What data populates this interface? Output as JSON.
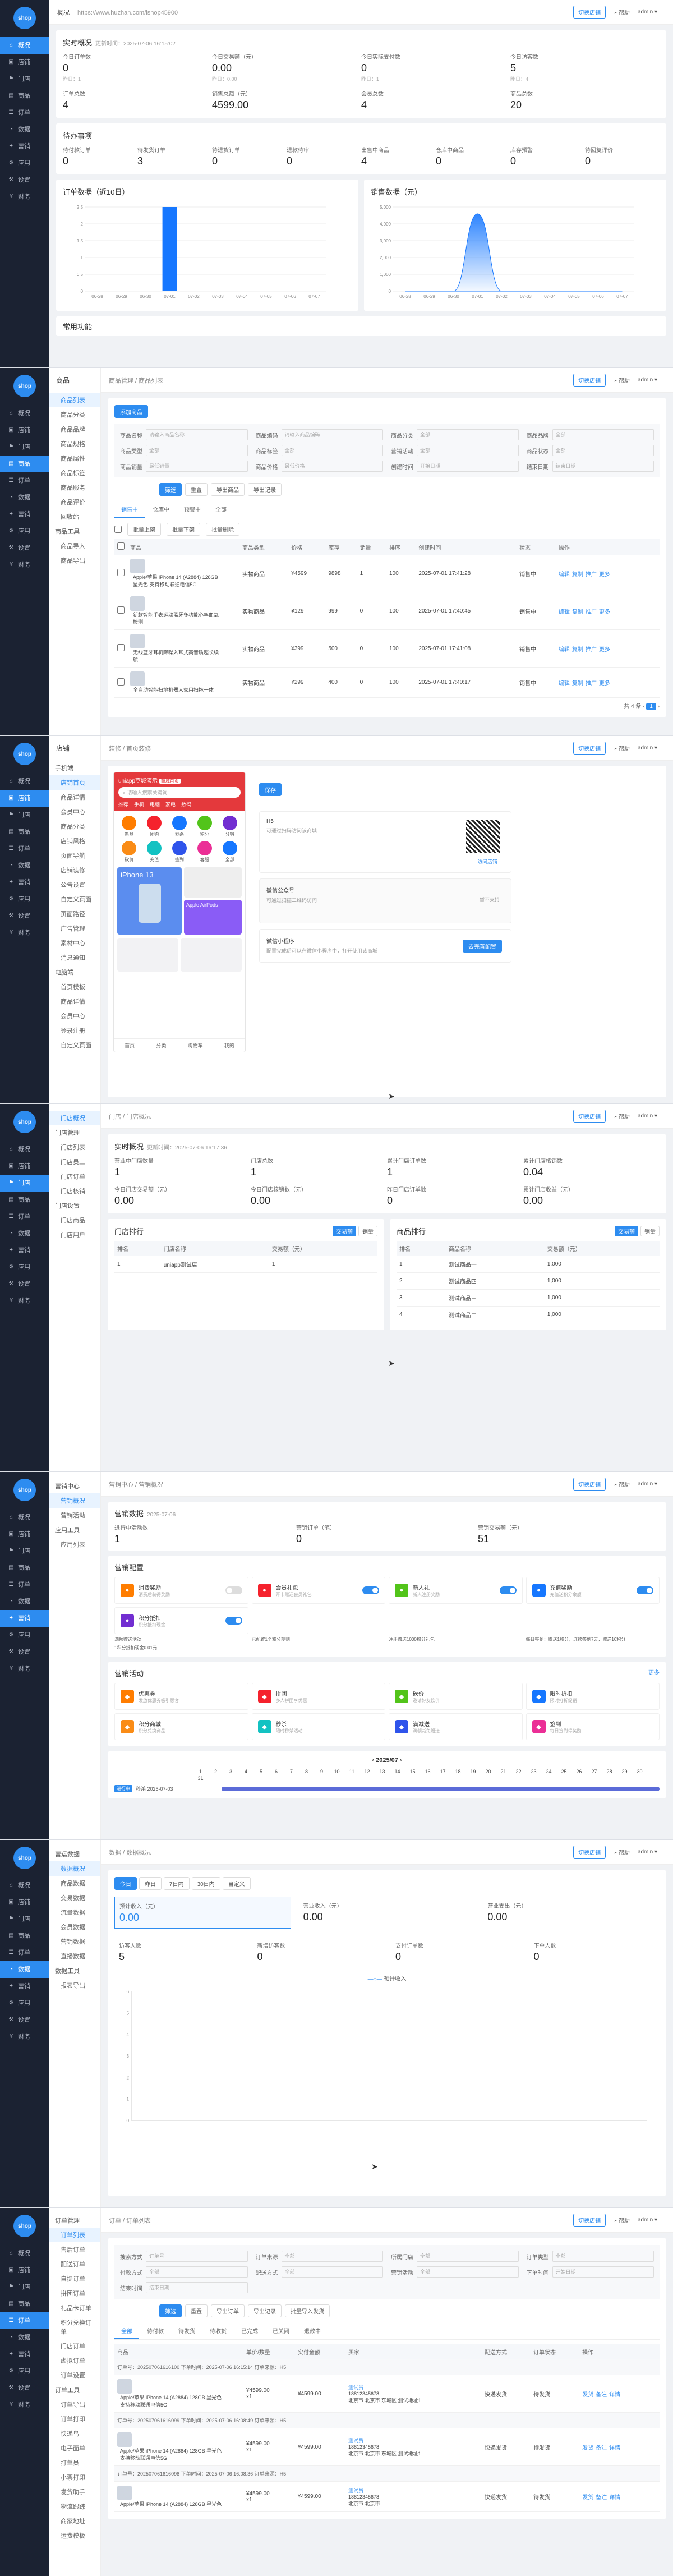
{
  "watermark": "https://www.huzhan.com/ishop45900",
  "user": {
    "avatar": "admin",
    "name": "admin",
    "help": "帮助",
    "store_btn": "切换店铺"
  },
  "menu": [
    "概况",
    "店铺",
    "门店",
    "商品",
    "订单",
    "数据",
    "营销",
    "应用",
    "设置",
    "财务"
  ],
  "s1": {
    "bc": "概况",
    "rt_title": "实时概况",
    "rt_time": "更新时间：2025-07-06 16:15:02",
    "kpis": [
      {
        "l": "今日订单数",
        "v": "0",
        "s": "昨日：1"
      },
      {
        "l": "今日交易额（元）",
        "v": "0.00",
        "s": "昨日：0.00"
      },
      {
        "l": "今日实际支付数",
        "v": "0",
        "s": "昨日：1"
      },
      {
        "l": "今日访客数",
        "v": "5",
        "s": "昨日：4"
      },
      {
        "l": "订单总数",
        "v": "4",
        "s": ""
      },
      {
        "l": "销售总额（元）",
        "v": "4599.00",
        "s": ""
      },
      {
        "l": "会员总数",
        "v": "4",
        "s": ""
      },
      {
        "l": "商品总数",
        "v": "20",
        "s": ""
      }
    ],
    "todo_title": "待办事项",
    "todo": [
      {
        "l": "待付款订单",
        "v": "0"
      },
      {
        "l": "待发货订单",
        "v": "3"
      },
      {
        "l": "待退货订单",
        "v": "0"
      },
      {
        "l": "退款待审",
        "v": "0"
      },
      {
        "l": "出售中商品",
        "v": "4"
      },
      {
        "l": "仓库中商品",
        "v": "0"
      },
      {
        "l": "库存预警",
        "v": "0"
      },
      {
        "l": "待回复评价",
        "v": "0"
      }
    ],
    "chart1_title": "订单数据（近10日）",
    "chart2_title": "销售数据（元）",
    "shop_title": "常用功能"
  },
  "chart_data": [
    {
      "type": "bar",
      "title": "订单数据（近10日）",
      "categories": [
        "06-28",
        "06-29",
        "06-30",
        "07-01",
        "07-02",
        "07-03",
        "07-04",
        "07-05",
        "07-06",
        "07-07"
      ],
      "values": [
        0,
        0,
        0,
        2.5,
        0,
        0,
        0,
        0,
        0,
        0
      ],
      "ylim": [
        0,
        2.5
      ],
      "yticks": [
        "0",
        "0.5",
        "1",
        "1.5",
        "2",
        "2.5"
      ],
      "color": "#1677ff"
    },
    {
      "type": "area",
      "title": "销售数据（元）",
      "categories": [
        "06-28",
        "06-29",
        "06-30",
        "07-01",
        "07-02",
        "07-03",
        "07-04",
        "07-05",
        "07-06",
        "07-07"
      ],
      "values": [
        0,
        0,
        0,
        4599,
        0,
        0,
        0,
        0,
        0,
        0
      ],
      "ylim": [
        0,
        5000
      ],
      "yticks": [
        "0",
        "1,000",
        "2,000",
        "3,000",
        "4,000",
        "5,000"
      ],
      "color": "#1677ff"
    }
  ],
  "s2": {
    "bc": "商品管理 / 商品列表",
    "side_title": "商品",
    "side": [
      "商品列表",
      "商品分类",
      "商品品牌",
      "商品规格",
      "商品属性",
      "商品标签",
      "商品服务",
      "商品评价",
      "回收站",
      "商品工具",
      "商品导入",
      "商品导出"
    ],
    "add": "添加商品",
    "fields": [
      {
        "l": "商品名称",
        "p": "请输入商品名称"
      },
      {
        "l": "商品编码",
        "p": "请输入商品编码"
      },
      {
        "l": "商品分类",
        "p": "全部"
      },
      {
        "l": "商品品牌",
        "p": "全部"
      },
      {
        "l": "商品类型",
        "p": "全部"
      },
      {
        "l": "商品标签",
        "p": "全部"
      },
      {
        "l": "营销活动",
        "p": "全部"
      },
      {
        "l": "商品状态",
        "p": "全部"
      },
      {
        "l": "商品销量",
        "p": "最低销量"
      },
      {
        "l": "商品价格",
        "p": "最低价格"
      },
      {
        "l": "创建时间",
        "p": "开始日期"
      },
      {
        "l": "结束日期",
        "p": "结束日期"
      }
    ],
    "btns": [
      "筛选",
      "重置",
      "导出商品",
      "导出记录"
    ],
    "tabs": [
      "销售中",
      "仓库中",
      "预警中",
      "全部"
    ],
    "batch": [
      "批量上架",
      "批量下架",
      "批量删除"
    ],
    "cols": [
      "商品",
      "商品类型",
      "价格",
      "库存",
      "销量",
      "排序",
      "创建时间",
      "状态",
      "操作"
    ],
    "rows": [
      {
        "n": "Apple/苹果 iPhone 14 (A2884) 128GB 星光色 支持移动联通电信5G",
        "t": "实物商品",
        "p": "¥4599",
        "s": "9898",
        "x": "1",
        "o": "100",
        "d": "2025-07-01 17:41:28",
        "st": "销售中"
      },
      {
        "n": "新款智能手表运动蓝牙多功能心率血氧检测",
        "t": "实物商品",
        "p": "¥129",
        "s": "999",
        "x": "0",
        "o": "100",
        "d": "2025-07-01 17:40:45",
        "st": "销售中"
      },
      {
        "n": "无线蓝牙耳机降噪入耳式高音质超长续航",
        "t": "实物商品",
        "p": "¥399",
        "s": "500",
        "x": "0",
        "o": "100",
        "d": "2025-07-01 17:41:08",
        "st": "销售中"
      },
      {
        "n": "全自动智能扫地机器人家用扫拖一体",
        "t": "实物商品",
        "p": "¥299",
        "s": "400",
        "x": "0",
        "o": "100",
        "d": "2025-07-01 17:40:17",
        "st": "销售中"
      }
    ],
    "ops": [
      "编辑",
      "复制",
      "推广",
      "更多"
    ],
    "pager": "共 4 条"
  },
  "s3": {
    "bc": "装修 / 首页装修",
    "side_title": "店铺",
    "side": [
      "手机端",
      "店铺首页",
      "商品详情",
      "会员中心",
      "商品分类",
      "店铺风格",
      "页面导航",
      "店铺装修",
      "公告设置",
      "自定义页面",
      "页面路径",
      "广告管理",
      "素材中心",
      "消息通知",
      "电脑端",
      "首页模板",
      "商品详情",
      "会员中心",
      "登录注册",
      "自定义页面"
    ],
    "shop_name": "uniapp商城演示",
    "shop_tag": "商城首页",
    "search": "请输入搜索关键词",
    "cats": [
      "推荐",
      "手机",
      "电脑",
      "家电",
      "数码"
    ],
    "icons": [
      "新品",
      "团购",
      "秒杀",
      "积分",
      "分销",
      "砍价",
      "充值",
      "签到",
      "客服",
      "全部"
    ],
    "banner": "iPhone 13",
    "promo": "Apple AirPods",
    "tabbar": [
      "首页",
      "分类",
      "购物车",
      "我的"
    ],
    "save": "保存",
    "h5_title": "H5",
    "h5_desc": "可通过扫码访问该商城",
    "h5_btn": "访问店铺",
    "mp_title": "微信公众号",
    "mp_desc": "可通过扫描二维码访问",
    "mp_btn": "暂不支持",
    "wx_title": "微信小程序",
    "wx_desc": "配置完成后可以在微信小程序中，打开使用该商城",
    "wx_btn": "去完善配置"
  },
  "s4": {
    "bc": "门店 / 门店概况",
    "side": [
      "门店概况",
      "门店管理",
      "门店列表",
      "门店员工",
      "门店订单",
      "门店核销",
      "门店设置",
      "门店商品",
      "门店用户"
    ],
    "rt_title": "实时概况",
    "rt_time": "更新时间：2025-07-06 16:17:36",
    "kpis": [
      {
        "l": "营业中门店数量",
        "v": "1"
      },
      {
        "l": "门店总数",
        "v": "1"
      },
      {
        "l": "累计门店订单数",
        "v": "1"
      },
      {
        "l": "累计门店核销数",
        "v": "0.04"
      },
      {
        "l": "今日门店交易额（元）",
        "v": "0.00"
      },
      {
        "l": "今日门店核销数（元）",
        "v": "0.00"
      },
      {
        "l": "昨日门店订单数",
        "v": "0"
      },
      {
        "l": "累计门店收益（元）",
        "v": "0.00"
      }
    ],
    "rank1": "门店排行",
    "rank2": "商品排行",
    "tab1": "交易额",
    "tab2": "销量",
    "r1cols": [
      "排名",
      "门店名称",
      "交易额（元）"
    ],
    "r1rows": [
      {
        "a": "1",
        "b": "uniapp测试店",
        "c": "1"
      }
    ],
    "r2cols": [
      "排名",
      "商品名称",
      "交易额（元）"
    ],
    "r2rows": [
      {
        "a": "1",
        "b": "测试商品一",
        "c": "1,000"
      },
      {
        "a": "2",
        "b": "测试商品四",
        "c": "1,000"
      },
      {
        "a": "3",
        "b": "测试商品三",
        "c": "1,000"
      },
      {
        "a": "4",
        "b": "测试商品二",
        "c": "1,000"
      }
    ]
  },
  "s5": {
    "bc": "营销中心 / 营销概况",
    "side": [
      "营销中心",
      "营销概况",
      "营销活动",
      "应用工具",
      "应用列表"
    ],
    "ov_title": "营销数据",
    "ov_time": "2025-07-06",
    "kpis": [
      {
        "l": "进行中活动数",
        "v": "1"
      },
      {
        "l": "营销订单（笔）",
        "v": "0"
      },
      {
        "l": "营销交易额（元）",
        "v": "51"
      }
    ],
    "cfg_title": "营销配置",
    "cfgs": [
      {
        "t": "消费奖励",
        "d": "消费后获得奖励",
        "c": "#ff7d00",
        "on": false
      },
      {
        "t": "会员礼包",
        "d": "开卡赠送会员礼包",
        "c": "#f5222d",
        "on": true
      },
      {
        "t": "新人礼",
        "d": "新人注册奖励",
        "c": "#52c41a",
        "on": true
      },
      {
        "t": "充值奖励",
        "d": "充值送积分余额",
        "c": "#1677ff",
        "on": true
      },
      {
        "t": "积分抵扣",
        "d": "积分抵扣现金",
        "c": "#722ed1",
        "on": true
      }
    ],
    "cfg_notes": [
      "满额赠送活动",
      "已配置1个积分规则",
      "注册赠送1000积分礼包",
      "每日签到：赠送1积分，连续签到7天，赠送10积分"
    ],
    "sign_note": "1积分抵扣现金0.01元",
    "act_title": "营销活动",
    "act_more": "更多",
    "acts": [
      {
        "t": "优惠券",
        "d": "发放优惠券吸引顾客",
        "c": "#ff7d00"
      },
      {
        "t": "拼团",
        "d": "多人拼团享优惠",
        "c": "#f5222d"
      },
      {
        "t": "砍价",
        "d": "邀请好友砍价",
        "c": "#52c41a"
      },
      {
        "t": "限时折扣",
        "d": "限时打折促销",
        "c": "#1677ff"
      },
      {
        "t": "积分商城",
        "d": "积分兑换商品",
        "c": "#fa8c16"
      },
      {
        "t": "秒杀",
        "d": "限时秒杀活动",
        "c": "#13c2c2"
      },
      {
        "t": "满减送",
        "d": "满额减免赠送",
        "c": "#2f54eb"
      },
      {
        "t": "签到",
        "d": "每日签到得奖励",
        "c": "#eb2f96"
      }
    ],
    "month": "2025/07",
    "days": [
      "1",
      "2",
      "3",
      "4",
      "5",
      "6",
      "7",
      "8",
      "9",
      "10",
      "11",
      "12",
      "13",
      "14",
      "15",
      "16",
      "17",
      "18",
      "19",
      "20",
      "21",
      "22",
      "23",
      "24",
      "25",
      "26",
      "27",
      "28",
      "29",
      "30",
      "31"
    ],
    "cal_tag": "进行中",
    "cal_ev": "秒杀 2025-07-03"
  },
  "s6": {
    "bc": "数据 / 数据概况",
    "side": [
      "营运数据",
      "数据概况",
      "商品数据",
      "交易数据",
      "流量数据",
      "会员数据",
      "营销数据",
      "直播数据",
      "数据工具",
      "报表导出"
    ],
    "ranges": [
      "今日",
      "昨日",
      "7日内",
      "30日内",
      "自定义"
    ],
    "kpis": [
      {
        "l": "预计收入（元）",
        "v": "0.00"
      },
      {
        "l": "营业收入（元）",
        "v": "0.00"
      },
      {
        "l": "营业支出（元）",
        "v": "0.00"
      },
      {
        "l": "访客人数",
        "v": "5"
      },
      {
        "l": "新增访客数",
        "v": "0"
      },
      {
        "l": "支付订单数",
        "v": "0"
      },
      {
        "l": "下单人数",
        "v": "0"
      }
    ],
    "legend": "预计收入",
    "ylabels": [
      "0",
      "1",
      "2",
      "3",
      "4",
      "5",
      "6"
    ]
  },
  "s7": {
    "bc": "订单 / 订单列表",
    "side_title": "订单管理",
    "side": [
      "订单列表",
      "售后订单",
      "配送订单",
      "自提订单",
      "拼团订单",
      "礼品卡订单",
      "积分兑换订单",
      "门店订单",
      "虚拟订单",
      "订单设置",
      "订单工具",
      "订单导出",
      "订单打印",
      "快递鸟",
      "电子面单",
      "打单员",
      "小票打印",
      "发货助手",
      "物流跟踪",
      "商家地址",
      "运费模板"
    ],
    "fields": [
      {
        "l": "搜索方式",
        "p": "订单号"
      },
      {
        "l": "订单来源",
        "p": "全部"
      },
      {
        "l": "所属门店",
        "p": "全部"
      },
      {
        "l": "订单类型",
        "p": "全部"
      },
      {
        "l": "付款方式",
        "p": "全部"
      },
      {
        "l": "配送方式",
        "p": "全部"
      },
      {
        "l": "营销活动",
        "p": "全部"
      },
      {
        "l": "下单时间",
        "p": "开始日期"
      },
      {
        "l": "结束时间",
        "p": "结束日期"
      }
    ],
    "btns": [
      "筛选",
      "重置",
      "导出订单",
      "导出记录",
      "批量导入发货"
    ],
    "tabs": [
      "全部",
      "待付款",
      "待发货",
      "待收货",
      "已完成",
      "已关闭",
      "退款中"
    ],
    "cols": [
      "商品",
      "单价/数量",
      "实付金额",
      "买家",
      "配送方式",
      "订单状态",
      "操作"
    ],
    "orders": [
      {
        "h": "订单号：202507061616100 下单时间：2025-07-06 16:15:14 订单来源：H5",
        "n": "Apple/苹果 iPhone 14 (A2884) 128GB 星光色 支持移动联通电信5G",
        "p": "¥4599.00",
        "q": "x1",
        "m": "¥4599.00",
        "b": "测试员",
        "ph": "18812345678",
        "a": "北京市 北京市 东城区 测试地址1",
        "d": "快递发货",
        "s": "待发货"
      },
      {
        "h": "订单号：202507061616099 下单时间：2025-07-06 16:08:49 订单来源：H5",
        "n": "Apple/苹果 iPhone 14 (A2884) 128GB 星光色 支持移动联通电信5G",
        "p": "¥4599.00",
        "q": "x1",
        "m": "¥4599.00",
        "b": "测试员",
        "ph": "18812345678",
        "a": "北京市 北京市 东城区 测试地址1",
        "d": "快递发货",
        "s": "待发货"
      },
      {
        "h": "订单号：202507061616098 下单时间：2025-07-06 16:08:36 订单来源：H5",
        "n": "Apple/苹果 iPhone 14 (A2884) 128GB 星光色",
        "p": "¥4599.00",
        "q": "x1",
        "m": "¥4599.00",
        "b": "测试员",
        "ph": "18812345678",
        "a": "北京市 北京市",
        "d": "快递发货",
        "s": "待发货"
      }
    ],
    "ops": [
      "发货",
      "备注",
      "详情"
    ]
  }
}
